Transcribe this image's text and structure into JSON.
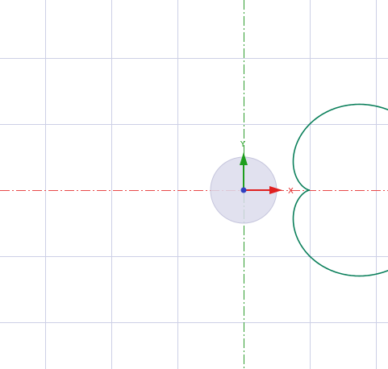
{
  "viewport": {
    "background": "#ffffff",
    "grid_color": "#cdd0e6",
    "x_axis_color": "#e84a4a",
    "y_axis_color": "#2f9e2f",
    "curve_color": "#0a7f5a",
    "curve_shape": "cardioid"
  },
  "triad": {
    "x_label": "X",
    "y_label": "Y",
    "x_arrow_color": "#e02020",
    "y_arrow_color": "#1e9e1e",
    "origin_color": "#3040c0"
  }
}
